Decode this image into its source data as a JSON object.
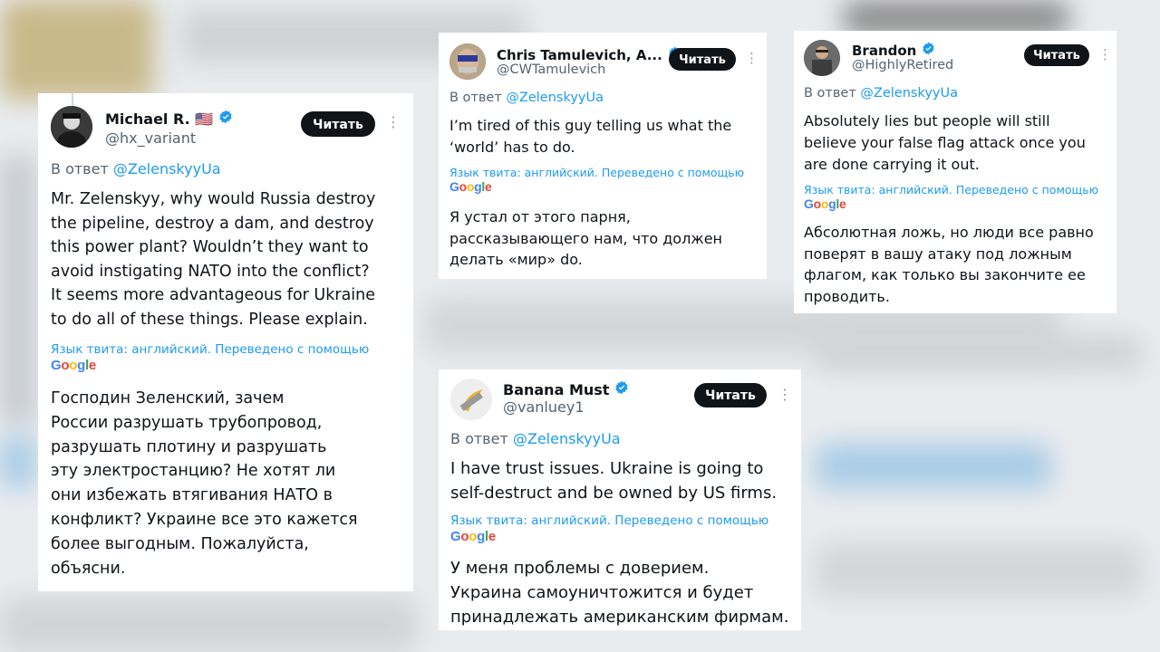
{
  "accent_blue": "#1d9bf0",
  "button_color": "#0f1419",
  "google_logo": {
    "letters": [
      "G",
      "o",
      "o",
      "g",
      "l",
      "e"
    ]
  },
  "tweets": [
    {
      "name": "Michael R. 🇺🇸",
      "handle": "@hx_variant",
      "follow_label": "Читать",
      "reply_prefix": "В ответ",
      "reply_mention": "@ZelenskyyUa",
      "text_en": "Mr. Zelenskyy, why would Russia destroy\nthe pipeline, destroy a dam, and destroy\nthis power plant? Wouldn’t they want to\navoid instigating NATO into the conflict?\nIt seems more advantageous for Ukraine\nto do all of these things. Please explain.",
      "translate_note": "Язык твита: английский. Переведено с помощью",
      "text_ru": "Господин Зеленский, зачем\nРоссии разрушать трубопровод,\nразрушать плотину и разрушать\nэту электростанцию? Не хотят ли\nони избежать втягивания НАТО в\nконфликт? Украине все это кажется\nболее выгодным. Пожалуйста,\nобъясни."
    },
    {
      "name": "Chris Tamulevich, A...",
      "handle": "@CWTamulevich",
      "follow_label": "Читать",
      "reply_prefix": "В ответ",
      "reply_mention": "@ZelenskyyUa",
      "text_en": "I’m tired of this guy telling us what the\n‘world’ has to do.",
      "translate_note": "Язык твита: английский. Переведено с помощью",
      "text_ru": "Я устал от этого парня,\nрассказывающего нам, что должен\nделать «мир» do."
    },
    {
      "name": "Brandon",
      "handle": "@HighlyRetired",
      "follow_label": "Читать",
      "reply_prefix": "В ответ",
      "reply_mention": "@ZelenskyyUa",
      "text_en": "Absolutely lies but people will still\nbelieve your false flag attack once you\nare done carrying it out.",
      "translate_note": "Язык твита: английский. Переведено с помощью",
      "text_ru": "Абсолютная ложь, но люди все равно\nповерят в вашу атаку под ложным\nфлагом, как только вы закончите ее\nпроводить."
    },
    {
      "name": "Banana Must",
      "handle": "@vanluey1",
      "follow_label": "Читать",
      "reply_prefix": "В ответ",
      "reply_mention": "@ZelenskyyUa",
      "text_en": "I have trust issues. Ukraine is going to\nself-destruct and be owned by US firms.",
      "translate_note": "Язык твита: английский. Переведено с помощью",
      "text_ru": "У меня проблемы с доверием.\nУкраина самоуничтожится и будет\nпринадлежать американским фирмам."
    }
  ]
}
